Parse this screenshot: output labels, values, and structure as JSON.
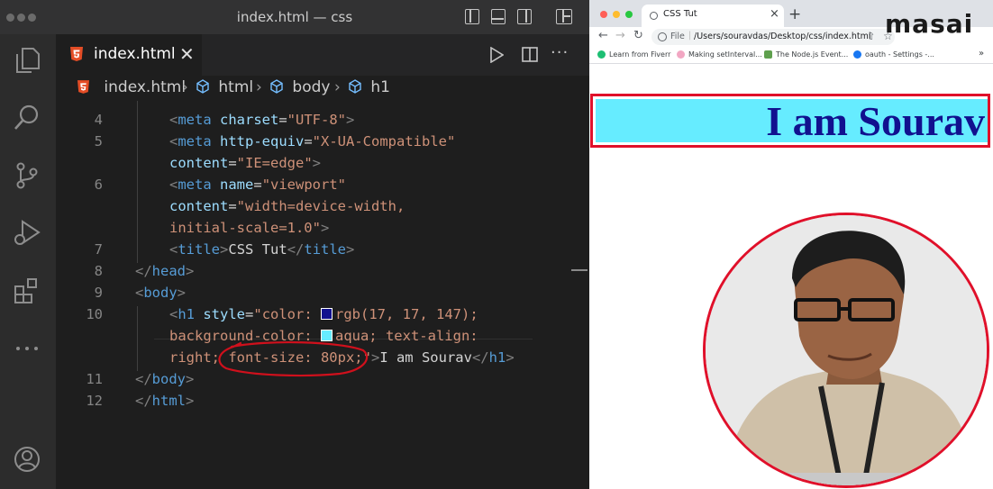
{
  "window": {
    "title": "index.html — css"
  },
  "editor": {
    "tab": {
      "label": "index.html"
    },
    "breadcrumb": [
      "index.html",
      "html",
      "body",
      "h1"
    ],
    "line_numbers": [
      "4",
      "5",
      "6",
      "7",
      "8",
      "9",
      "10",
      "11",
      "12"
    ],
    "code": {
      "l4": {
        "t1": "<",
        "tag": "meta",
        "a1": " charset",
        "eq": "=",
        "s1": "\"UTF-8\"",
        "t2": ">"
      },
      "l5a": {
        "t1": "<",
        "tag": "meta",
        "a1": " http-equiv",
        "eq": "=",
        "s1": "\"X-UA-Compatible\""
      },
      "l5b": {
        "a1": "content",
        "eq": "=",
        "s1": "\"IE=edge\"",
        "t2": ">"
      },
      "l6a": {
        "t1": "<",
        "tag": "meta",
        "a1": " name",
        "eq": "=",
        "s1": "\"viewport\""
      },
      "l6b": {
        "a1": "content",
        "eq": "=",
        "s1": "\"width=device-width,"
      },
      "l6c": {
        "s1": "initial-scale=1.0\"",
        "t2": ">"
      },
      "l7": {
        "t1": "<",
        "tag": "title",
        "t2": ">",
        "text": "CSS Tut",
        "t3": "</",
        "tag2": "title",
        "t4": ">"
      },
      "l8": {
        "t1": "</",
        "tag": "head",
        "t2": ">"
      },
      "l9": {
        "t1": "<",
        "tag": "body",
        "t2": ">"
      },
      "l10a": {
        "t1": "<",
        "tag": "h1",
        "a1": " style",
        "eq": "=",
        "s1": "\"color: ",
        "s2": "rgb(17, 17, 147);"
      },
      "l10b": {
        "s1": "background-color: ",
        "s2": "aqua; text-align:"
      },
      "l10c": {
        "s1": "right; font-size: 80px;\"",
        "t2": ">",
        "text": "I am Sourav",
        "t3": "</",
        "tag2": "h1",
        "t4": ">"
      },
      "l11": {
        "t1": "</",
        "tag": "body",
        "t2": ">"
      },
      "l12": {
        "t1": "</",
        "tag": "html",
        "t2": ">"
      }
    },
    "swatches": {
      "color": "#11118f",
      "background": "#66ecff"
    },
    "annotation_color": "#d0101c"
  },
  "browser": {
    "tab_title": "CSS Tut",
    "new_tab": "+",
    "address": {
      "label": "File",
      "url": "/Users/souravdas/Desktop/css/index.html"
    },
    "bookmarks": [
      "Learn from Fiverr",
      "Making setInterval...",
      "The Node.js Event...",
      "oauth - Settings -..."
    ],
    "bookmarks_more": "»",
    "page": {
      "heading": "I am Sourav"
    },
    "watermark": "masai"
  }
}
